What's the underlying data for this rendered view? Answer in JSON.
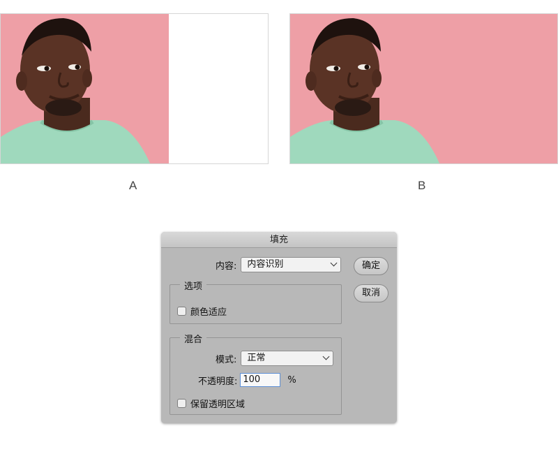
{
  "comparison": {
    "label_a": "A",
    "label_b": "B"
  },
  "dialog": {
    "title": "填充",
    "content_label": "内容:",
    "content_value": "内容识别",
    "ok_button": "确定",
    "cancel_button": "取消",
    "options_group": {
      "title": "选项",
      "color_adapt_label": "颜色适应",
      "color_adapt_checked": false
    },
    "blend_group": {
      "title": "混合",
      "mode_label": "模式:",
      "mode_value": "正常",
      "opacity_label": "不透明度:",
      "opacity_value": "100",
      "opacity_unit": "%",
      "preserve_label": "保留透明区域",
      "preserve_checked": false
    }
  },
  "colors": {
    "background_pink": "#ee9fa6",
    "shirt_mint": "#9fd9bd",
    "dialog_gray": "#b8b8b8"
  }
}
